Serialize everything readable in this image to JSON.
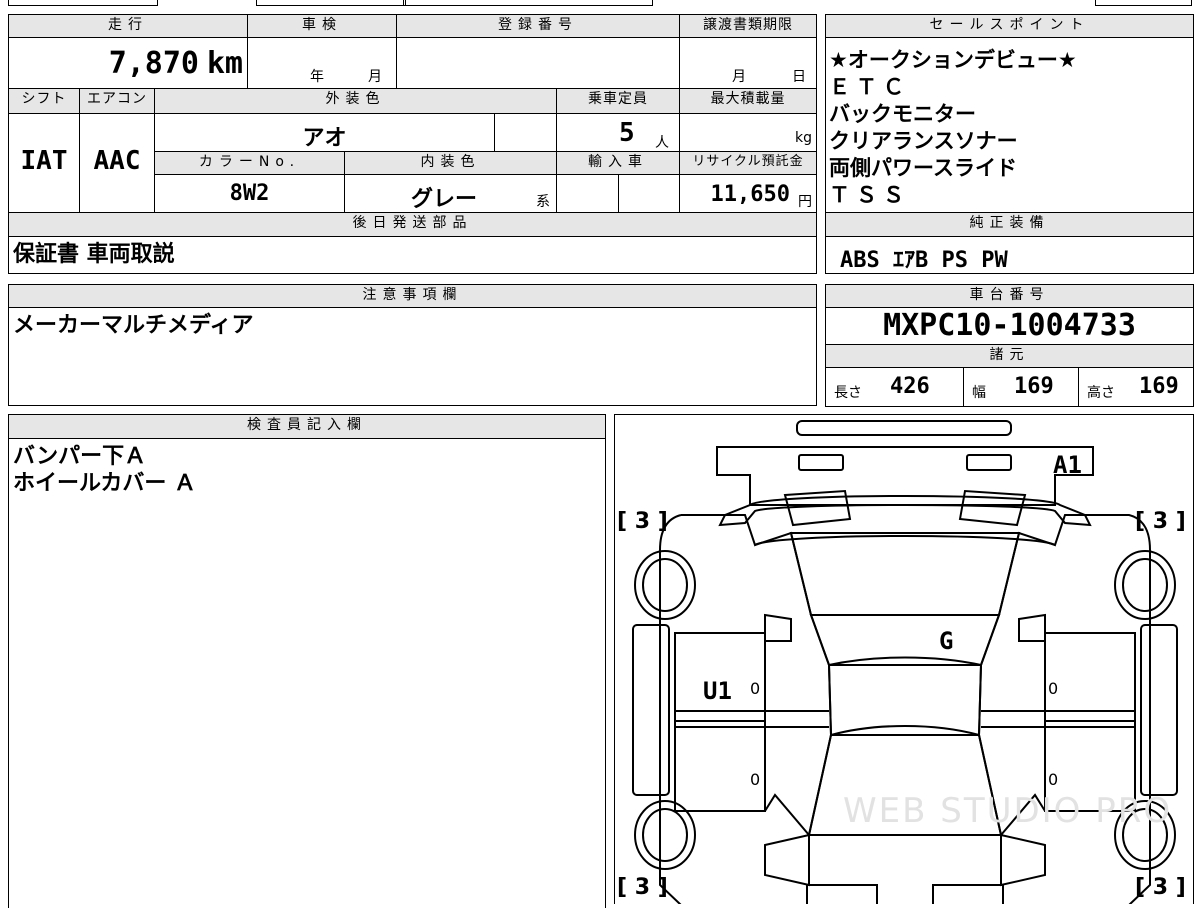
{
  "top": {
    "mileage_label": "走行",
    "mileage_value": "7,870",
    "mileage_unit": "km",
    "inspection_label": "車検",
    "inspection_year_unit": "年",
    "inspection_month_unit": "月",
    "registration_label": "登録番号",
    "transfer_label": "譲渡書類期限",
    "transfer_month_unit": "月",
    "transfer_day_unit": "日"
  },
  "specs": {
    "shift_label": "シフト",
    "shift_value": "IAT",
    "ac_label": "エアコン",
    "ac_value": "AAC",
    "exterior_label": "外装色",
    "exterior_value": "アオ",
    "capacity_label": "乗車定員",
    "capacity_value": "5",
    "capacity_unit": "人",
    "load_label": "最大積載量",
    "load_unit": "kg",
    "color_no_label": "カラーNo.",
    "color_no_value": "8W2",
    "interior_label": "内装色",
    "interior_value": "グレー",
    "interior_suffix": "系",
    "import_label": "輸入車",
    "recycle_label": "リサイクル預託金",
    "recycle_value": "11,650",
    "recycle_unit": "円"
  },
  "later_parts": {
    "label": "後日発送部品",
    "value": "保証書 車両取説"
  },
  "notes": {
    "label": "注意事項欄",
    "value": "メーカーマルチメディア"
  },
  "sales_points": {
    "label": "セールスポイント",
    "items": [
      "★オークションデビュー★",
      "ＥＴＣ",
      "バックモニター",
      "クリアランスソナー",
      "両側パワースライド",
      "ＴＳＳ"
    ]
  },
  "equipment": {
    "label": "純正装備",
    "value": "ABS ｴｱB PS PW"
  },
  "chassis": {
    "label": "車台番号",
    "value": "MXPC10-1004733"
  },
  "dimensions": {
    "label": "諸元",
    "length_label": "長さ",
    "length_value": "426",
    "width_label": "幅",
    "width_value": "169",
    "height_label": "高さ",
    "height_value": "169"
  },
  "inspector": {
    "label": "検査員記入欄",
    "lines": [
      "バンパー下Ａ",
      "ホイールカバー Ａ"
    ]
  },
  "diagram": {
    "marks": {
      "front_right": "A1",
      "roof": "G",
      "left_door": "U1",
      "tire_fl": "3",
      "tire_fr": "3",
      "tire_rl": "3",
      "tire_rr": "3",
      "door_fl_extra": "0",
      "door_fr_extra": "0",
      "door_rl_extra": "0",
      "door_rr_extra": "0"
    },
    "watermark": "WEB STUDIO PRO"
  }
}
